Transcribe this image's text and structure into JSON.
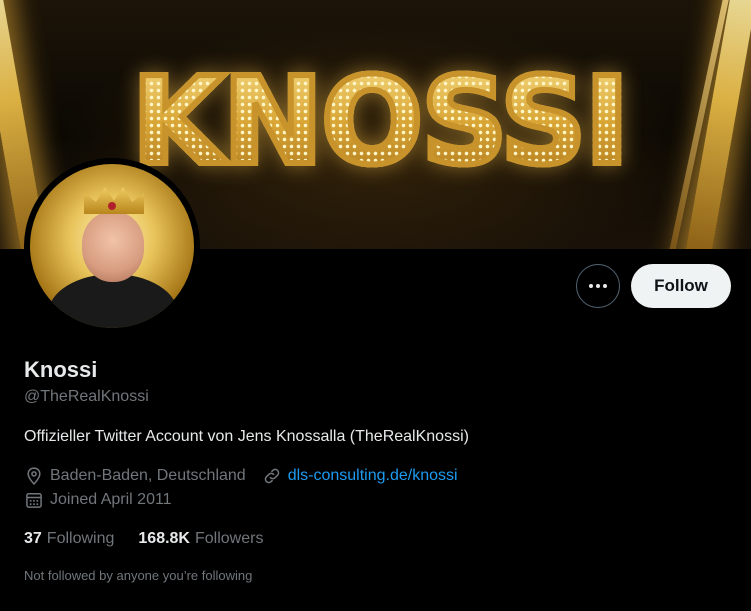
{
  "banner": {
    "logo_text": "KNOSSI"
  },
  "profile": {
    "name": "Knossi",
    "handle": "@TheRealKnossi",
    "bio": "Offizieller Twitter Account von Jens Knossalla (TheRealKnossi)",
    "location": "Baden-Baden, Deutschland",
    "website": "dls-consulting.de/knossi",
    "joined": "Joined April 2011"
  },
  "actions": {
    "more_icon": "more-dots-icon",
    "follow_label": "Follow"
  },
  "stats": {
    "following_count": "37",
    "following_label": "Following",
    "followers_count": "168.8K",
    "followers_label": "Followers"
  },
  "social_context": "Not followed by anyone you’re following",
  "icons": {
    "location": "location-pin-icon",
    "link": "link-icon",
    "calendar": "calendar-icon"
  },
  "colors": {
    "background": "#000000",
    "text_primary": "#e7e9ea",
    "text_secondary": "#71767b",
    "link": "#1d9bf0",
    "follow_button_bg": "#eff3f4"
  }
}
